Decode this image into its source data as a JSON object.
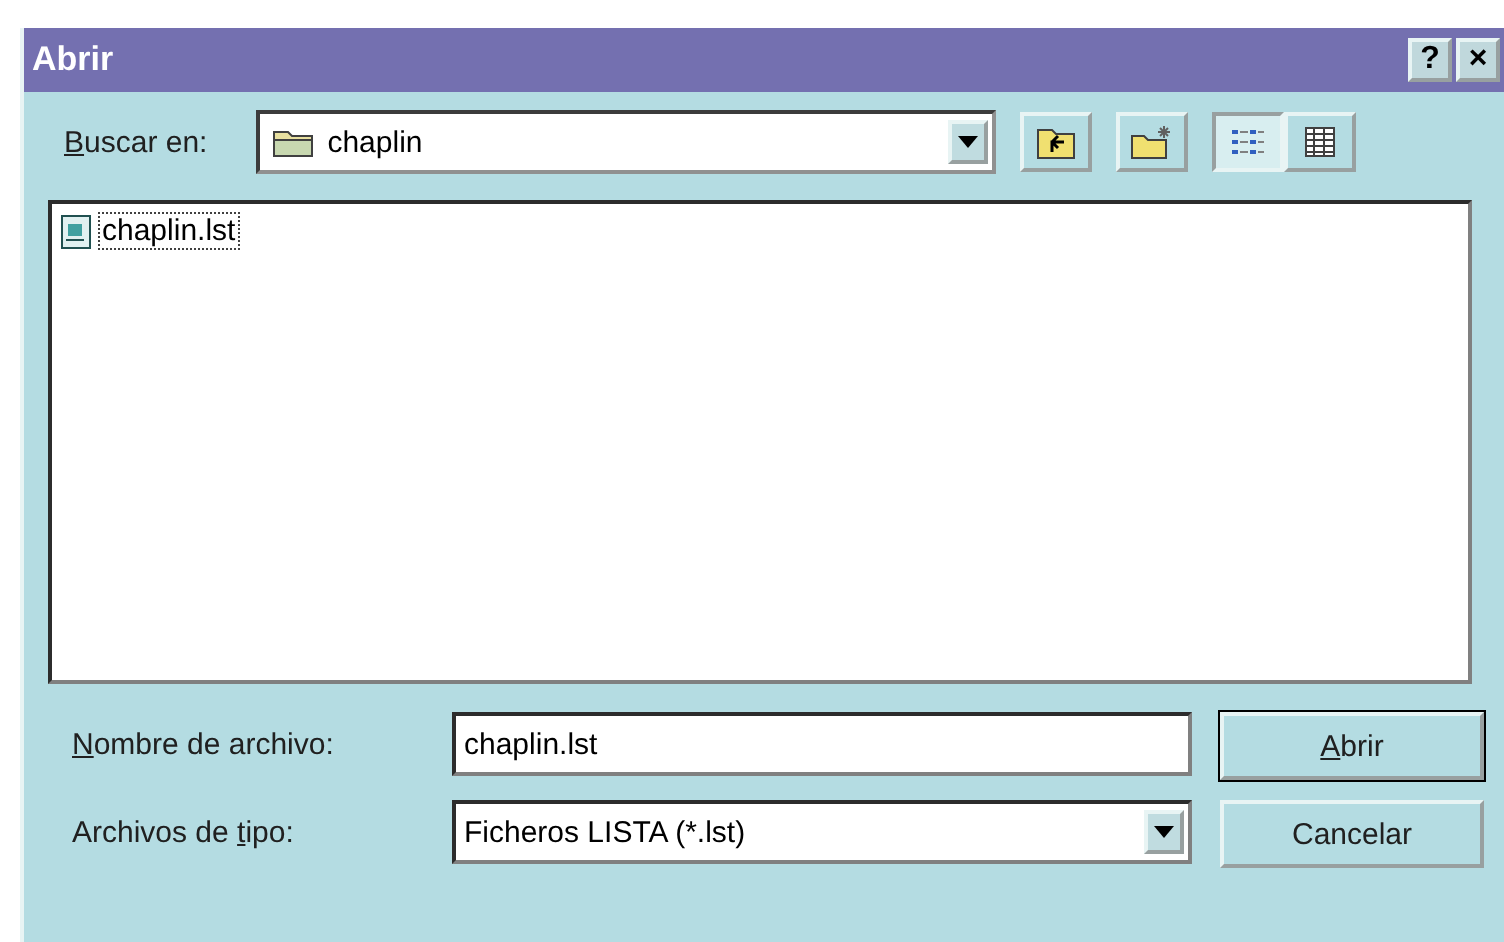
{
  "window": {
    "title": "Abrir",
    "title_buttons": [
      "?",
      "×"
    ]
  },
  "look_in": {
    "label": [
      {
        "text": "B",
        "underlined": true
      },
      {
        "text": "uscar en:",
        "underlined": false
      }
    ],
    "value": "chaplin"
  },
  "toolbar": {
    "view_buttons": [
      {
        "kind": "list",
        "selected": true
      },
      {
        "kind": "details",
        "selected": false
      }
    ]
  },
  "files": [
    {
      "name": "chaplin.lst",
      "focused": true
    }
  ],
  "file_name": {
    "label": [
      {
        "text": "N",
        "underlined": true
      },
      {
        "text": "ombre de archivo:",
        "underlined": false
      }
    ],
    "value": "chaplin.lst"
  },
  "file_type": {
    "label": [
      {
        "text": "Archivos de ",
        "underlined": false
      },
      {
        "text": "t",
        "underlined": true
      },
      {
        "text": "ipo:",
        "underlined": false
      }
    ],
    "value": "Ficheros LISTA (*.lst)"
  },
  "buttons": [
    {
      "label": [
        {
          "text": "A",
          "underlined": true
        },
        {
          "text": "brir",
          "underlined": false
        }
      ],
      "kind": "default"
    },
    {
      "label": [
        {
          "text": "Cancelar",
          "underlined": false
        }
      ],
      "kind": "normal"
    }
  ]
}
